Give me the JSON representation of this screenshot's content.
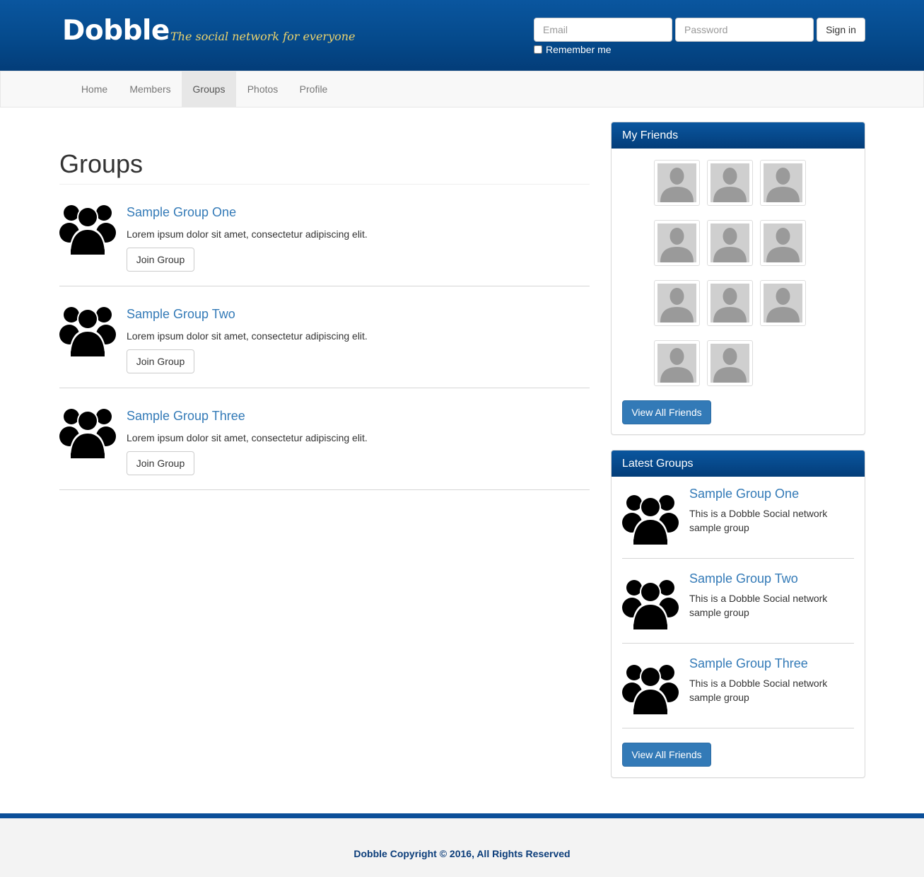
{
  "brand": {
    "logo": "Dobble",
    "tagline": "The social network for everyone"
  },
  "login": {
    "email_placeholder": "Email",
    "password_placeholder": "Password",
    "signin_label": "Sign in",
    "remember_label": "Remember me"
  },
  "nav": {
    "items": [
      {
        "label": "Home"
      },
      {
        "label": "Members"
      },
      {
        "label": "Groups",
        "active": true
      },
      {
        "label": "Photos"
      },
      {
        "label": "Profile"
      }
    ]
  },
  "main": {
    "title": "Groups",
    "groups": [
      {
        "title": "Sample Group One",
        "desc": "Lorem ipsum dolor sit amet, consectetur adipiscing elit.",
        "button": "Join Group"
      },
      {
        "title": "Sample Group Two",
        "desc": "Lorem ipsum dolor sit amet, consectetur adipiscing elit.",
        "button": "Join Group"
      },
      {
        "title": "Sample Group Three",
        "desc": "Lorem ipsum dolor sit amet, consectetur adipiscing elit.",
        "button": "Join Group"
      }
    ]
  },
  "friends_panel": {
    "heading": "My Friends",
    "friend_count": 11,
    "button": "View All Friends"
  },
  "latest_panel": {
    "heading": "Latest Groups",
    "groups": [
      {
        "title": "Sample Group One",
        "desc": "This is a Dobble Social network sample group"
      },
      {
        "title": "Sample Group Two",
        "desc": "This is a Dobble Social network sample group"
      },
      {
        "title": "Sample Group Three",
        "desc": "This is a Dobble Social network sample group"
      }
    ],
    "button": "View All Friends"
  },
  "footer": {
    "text": "Dobble Copyright © 2016, All Rights Reserved"
  },
  "colors": {
    "header_blue": "#054a8c",
    "link_blue": "#337ab7",
    "tagline_yellow": "#ecd36e",
    "footer_text": "#0b3d7a"
  },
  "icons": {
    "group": "users-group-icon",
    "friend": "user-silhouette-icon"
  }
}
